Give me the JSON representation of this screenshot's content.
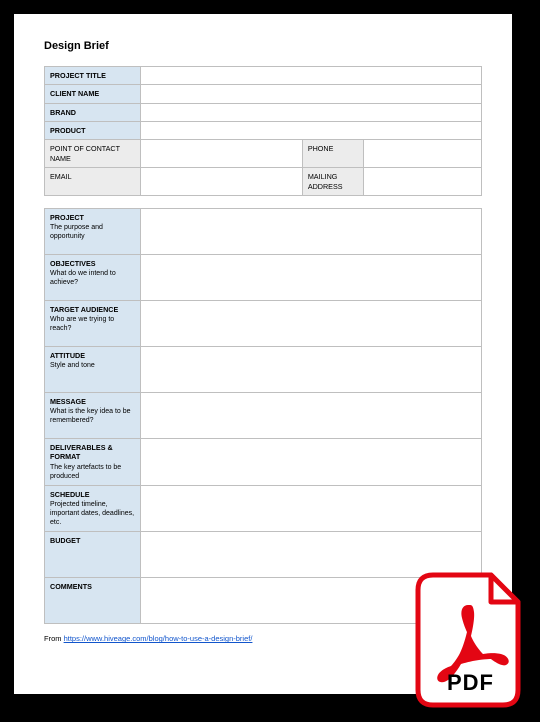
{
  "title": "Design Brief",
  "table1": {
    "project_title_label": "PROJECT TITLE",
    "project_title_value": "",
    "client_name_label": "CLIENT NAME",
    "client_name_value": "",
    "brand_label": "BRAND",
    "brand_value": "",
    "product_label": "PRODUCT",
    "product_value": "",
    "poc_label": "POINT OF CONTACT NAME",
    "poc_value": "",
    "phone_label": "PHONE",
    "phone_value": "",
    "email_label": "EMAIL",
    "email_value": "",
    "mailing_label": "MAILING ADDRESS",
    "mailing_value": ""
  },
  "table2": {
    "sections": [
      {
        "heading": "PROJECT",
        "sub": "The purpose and opportunity",
        "value": ""
      },
      {
        "heading": "OBJECTIVES",
        "sub": "What do we intend to achieve?",
        "value": ""
      },
      {
        "heading": "TARGET AUDIENCE",
        "sub": "Who are we trying to reach?",
        "value": ""
      },
      {
        "heading": "ATTITUDE",
        "sub": "Style and tone",
        "value": ""
      },
      {
        "heading": "MESSAGE",
        "sub": "What is the key idea to be remembered?",
        "value": ""
      },
      {
        "heading": "DELIVERABLES & FORMAT",
        "sub": "The key artefacts to be produced",
        "value": ""
      },
      {
        "heading": "SCHEDULE",
        "sub": "Projected timeline, important dates, deadlines, etc.",
        "value": ""
      },
      {
        "heading": "BUDGET",
        "sub": "",
        "value": ""
      },
      {
        "heading": "COMMENTS",
        "sub": "",
        "value": ""
      }
    ]
  },
  "credit": {
    "prefix": "From ",
    "link_text": "https://www.hiveage.com/blog/how-to-use-a-design-brief/"
  },
  "badge": {
    "label": "PDF"
  }
}
